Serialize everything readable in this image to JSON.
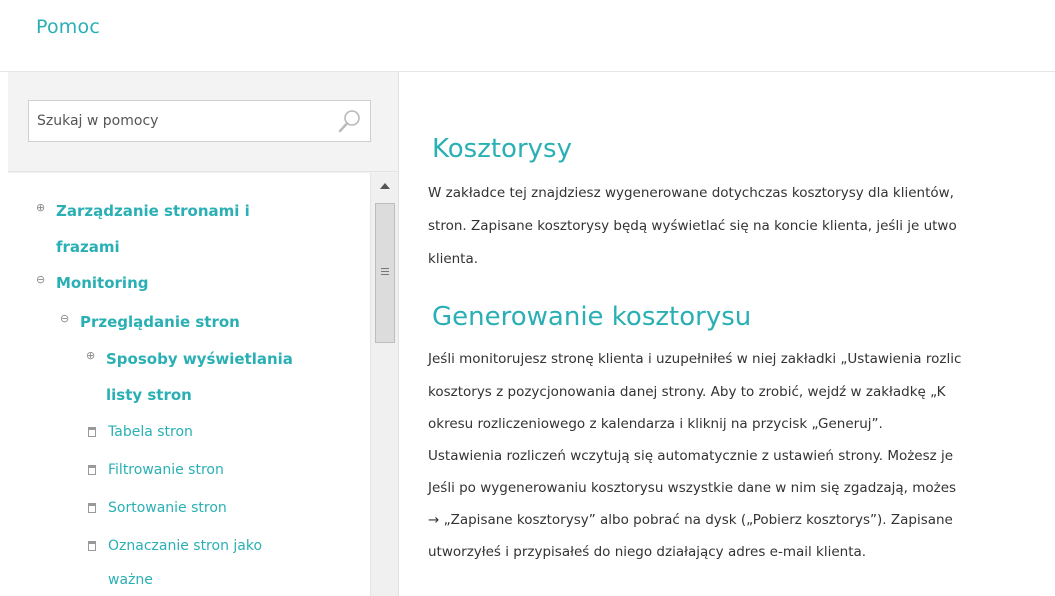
{
  "header": {
    "title": "Pomoc"
  },
  "search": {
    "placeholder": "Szukaj w pomocy"
  },
  "tree": [
    {
      "label": "Zarządzanie stronami i",
      "label2": "frazami",
      "toggle": "⊕"
    },
    {
      "label": "Monitoring",
      "toggle": "⊖"
    },
    {
      "label": "Przeglądanie stron",
      "toggle": "⊖"
    },
    {
      "label": "Sposoby wyświetlania",
      "label2": "listy stron",
      "toggle": "⊕"
    },
    {
      "label": "Tabela stron"
    },
    {
      "label": "Filtrowanie stron"
    },
    {
      "label": "Sortowanie stron"
    },
    {
      "label": "Oznaczanie stron jako",
      "label2": "ważne"
    }
  ],
  "article": {
    "heading1": "Kosztorysy",
    "intro": [
      "W zakładce tej znajdziesz wygenerowane dotychczas kosztorysy dla klientów,",
      "stron. Zapisane kosztorysy będą wyświetlać się na koncie klienta, jeśli je utwo",
      "klienta."
    ],
    "heading2": "Generowanie kosztorysu",
    "body": [
      "Jeśli monitorujesz stronę klienta i uzupełniłeś w niej zakładki „Ustawienia rozlic",
      "kosztorys z pozycjonowania danej strony. Aby to zrobić, wejdź w zakładkę „K",
      "okresu rozliczeniowego z kalendarza i kliknij na przycisk „Generuj”.",
      "Ustawienia rozliczeń wczytują się automatycznie z ustawień strony. Możesz je",
      "Jeśli po wygenerowaniu kosztorysu wszystkie dane w nim się zgadzają, możes",
      "→ „Zapisane kosztorysy” albo pobrać na dysk („Pobierz kosztorys”). Zapisane",
      "utworzyłeś i przypisałeś do niego działający adres e-mail klienta."
    ]
  }
}
